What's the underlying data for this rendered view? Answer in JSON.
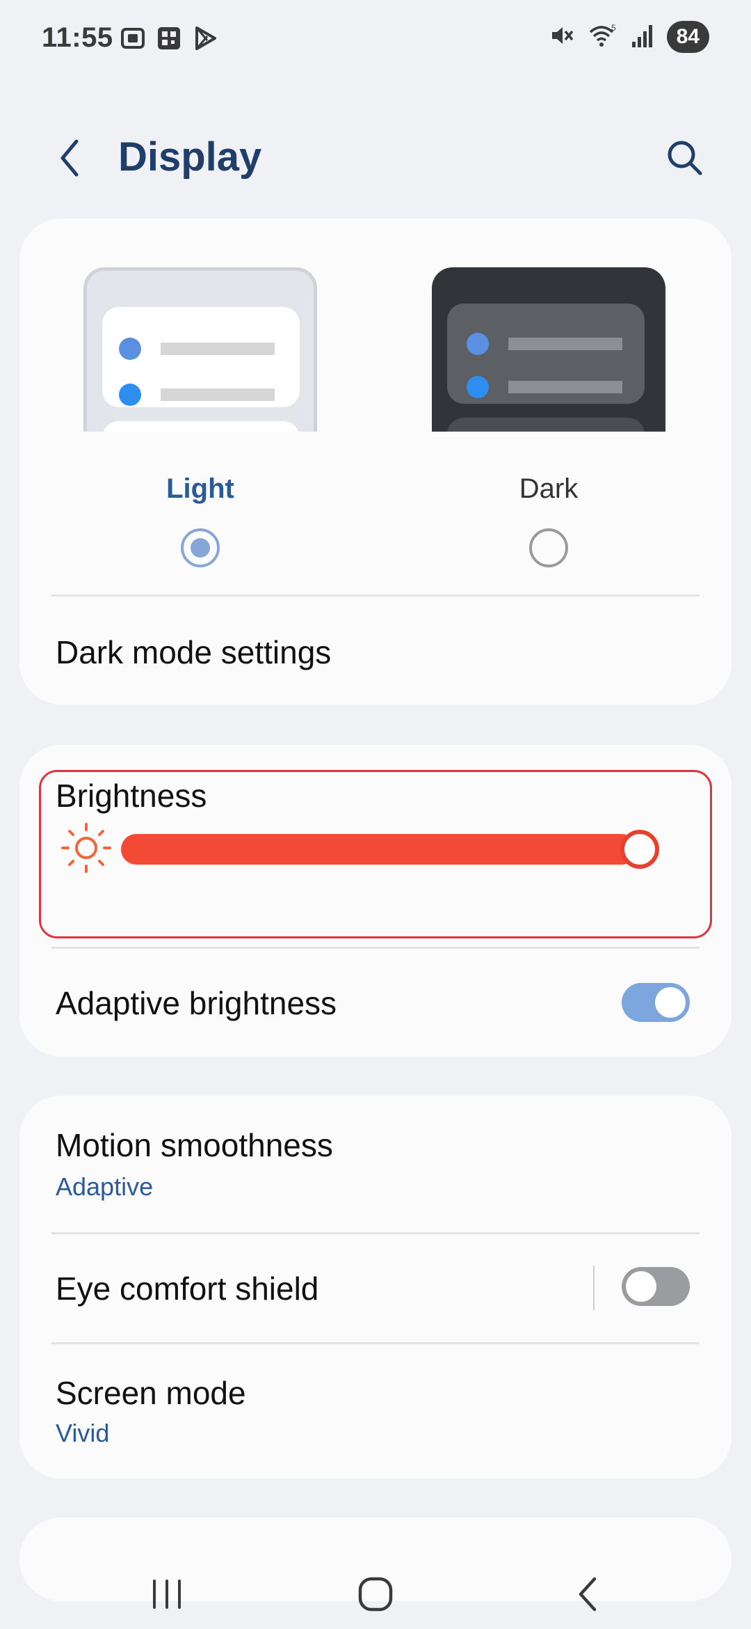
{
  "status": {
    "time": "11:55",
    "battery": "84",
    "icons_left": [
      "screenshot-icon",
      "qr-icon",
      "play-store-icon"
    ],
    "icons_right": [
      "mute-icon",
      "wifi-icon",
      "signal-icon",
      "battery-icon"
    ]
  },
  "header": {
    "title": "Display"
  },
  "theme": {
    "light_label": "Light",
    "dark_label": "Dark",
    "selected": "Light",
    "dark_mode_settings": "Dark mode settings"
  },
  "brightness": {
    "label": "Brightness",
    "level": 1.0,
    "accent_color": "#f24a35",
    "adaptive_label": "Adaptive brightness",
    "adaptive_on": true
  },
  "motion": {
    "title": "Motion smoothness",
    "value": "Adaptive"
  },
  "eye_comfort": {
    "title": "Eye comfort shield",
    "on": false
  },
  "screen_mode": {
    "title": "Screen mode",
    "value": "Vivid"
  },
  "colors": {
    "title": "#1f3f6a",
    "accent": "#2a5b98",
    "toggle_on": "#7ea6de"
  }
}
